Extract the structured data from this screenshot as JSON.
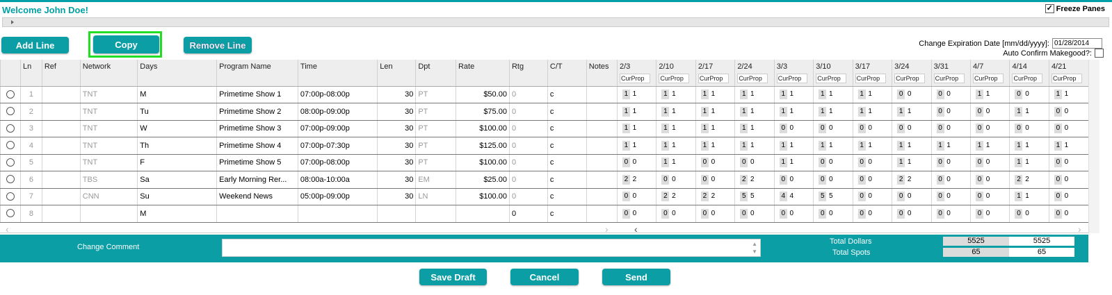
{
  "header": {
    "welcome": "Welcome John Doe!",
    "freeze_label": "Freeze Panes"
  },
  "toolbar": {
    "add": "Add Line",
    "copy": "Copy",
    "remove": "Remove Line"
  },
  "expiration": {
    "label": "Change Expiration Date [mm/dd/yyyy]:",
    "value": "01/28/2014",
    "auto_confirm": "Auto Confirm Makegood?:"
  },
  "columns": [
    "Ln",
    "Ref",
    "Network",
    "Days",
    "Program Name",
    "Time",
    "Len",
    "Dpt",
    "Rate",
    "Rtg",
    "C/T",
    "Notes"
  ],
  "weeks": [
    "2/3",
    "2/10",
    "2/17",
    "2/24",
    "3/3",
    "3/10",
    "3/17",
    "3/24",
    "3/31",
    "4/7",
    "4/14",
    "4/21"
  ],
  "sub_label": "CurProp",
  "rows": [
    {
      "ln": "1",
      "ref": "",
      "network": "TNT",
      "days": "M",
      "program": "Primetime Show 1",
      "time": "07:00p-08:00p",
      "len": "30",
      "dpt": "PT",
      "rate": "$50.00",
      "rtg": "0",
      "ct": "c",
      "notes": "",
      "spots": [
        [
          "1",
          "1"
        ],
        [
          "1",
          "1"
        ],
        [
          "1",
          "1"
        ],
        [
          "1",
          "1"
        ],
        [
          "1",
          "1"
        ],
        [
          "1",
          "1"
        ],
        [
          "1",
          "1"
        ],
        [
          "0",
          "0"
        ],
        [
          "0",
          "0"
        ],
        [
          "1",
          "1"
        ],
        [
          "0",
          "0"
        ],
        [
          "1",
          "1"
        ]
      ]
    },
    {
      "ln": "2",
      "ref": "",
      "network": "TNT",
      "days": "Tu",
      "program": "Primetime Show 2",
      "time": "08:00p-09:00p",
      "len": "30",
      "dpt": "PT",
      "rate": "$75.00",
      "rtg": "0",
      "ct": "c",
      "notes": "",
      "spots": [
        [
          "1",
          "1"
        ],
        [
          "1",
          "1"
        ],
        [
          "1",
          "1"
        ],
        [
          "1",
          "1"
        ],
        [
          "1",
          "1"
        ],
        [
          "1",
          "1"
        ],
        [
          "1",
          "1"
        ],
        [
          "1",
          "1"
        ],
        [
          "0",
          "0"
        ],
        [
          "0",
          "0"
        ],
        [
          "1",
          "1"
        ],
        [
          "0",
          "0"
        ]
      ]
    },
    {
      "ln": "3",
      "ref": "",
      "network": "TNT",
      "days": "W",
      "program": "Primetime Show 3",
      "time": "07:00p-09:00p",
      "len": "30",
      "dpt": "PT",
      "rate": "$100.00",
      "rtg": "0",
      "ct": "c",
      "notes": "",
      "spots": [
        [
          "1",
          "1"
        ],
        [
          "1",
          "1"
        ],
        [
          "1",
          "1"
        ],
        [
          "1",
          "1"
        ],
        [
          "0",
          "0"
        ],
        [
          "0",
          "0"
        ],
        [
          "0",
          "0"
        ],
        [
          "0",
          "0"
        ],
        [
          "0",
          "0"
        ],
        [
          "0",
          "0"
        ],
        [
          "0",
          "0"
        ],
        [
          "0",
          "0"
        ]
      ]
    },
    {
      "ln": "4",
      "ref": "",
      "network": "TNT",
      "days": "Th",
      "program": "Primetime Show 4",
      "time": "07:00p-07:30p",
      "len": "30",
      "dpt": "PT",
      "rate": "$125.00",
      "rtg": "0",
      "ct": "c",
      "notes": "",
      "spots": [
        [
          "1",
          "1"
        ],
        [
          "1",
          "1"
        ],
        [
          "1",
          "1"
        ],
        [
          "1",
          "1"
        ],
        [
          "1",
          "1"
        ],
        [
          "1",
          "1"
        ],
        [
          "1",
          "1"
        ],
        [
          "1",
          "1"
        ],
        [
          "1",
          "1"
        ],
        [
          "1",
          "1"
        ],
        [
          "1",
          "1"
        ],
        [
          "1",
          "1"
        ]
      ]
    },
    {
      "ln": "5",
      "ref": "",
      "network": "TNT",
      "days": "F",
      "program": "Primetime Show 5",
      "time": "07:00p-08:00p",
      "len": "30",
      "dpt": "PT",
      "rate": "$100.00",
      "rtg": "0",
      "ct": "c",
      "notes": "",
      "spots": [
        [
          "0",
          "0"
        ],
        [
          "1",
          "1"
        ],
        [
          "0",
          "0"
        ],
        [
          "0",
          "0"
        ],
        [
          "1",
          "1"
        ],
        [
          "0",
          "0"
        ],
        [
          "0",
          "0"
        ],
        [
          "1",
          "1"
        ],
        [
          "0",
          "0"
        ],
        [
          "0",
          "0"
        ],
        [
          "1",
          "1"
        ],
        [
          "0",
          "0"
        ]
      ]
    },
    {
      "ln": "6",
      "ref": "",
      "network": "TBS",
      "days": "Sa",
      "program": "Early Morning Rer...",
      "time": "08:00a-10:00a",
      "len": "30",
      "dpt": "EM",
      "rate": "$25.00",
      "rtg": "0",
      "ct": "c",
      "notes": "",
      "spots": [
        [
          "2",
          "2"
        ],
        [
          "0",
          "0"
        ],
        [
          "0",
          "0"
        ],
        [
          "2",
          "2"
        ],
        [
          "0",
          "0"
        ],
        [
          "0",
          "0"
        ],
        [
          "0",
          "0"
        ],
        [
          "2",
          "2"
        ],
        [
          "0",
          "0"
        ],
        [
          "0",
          "0"
        ],
        [
          "2",
          "2"
        ],
        [
          "0",
          "0"
        ]
      ]
    },
    {
      "ln": "7",
      "ref": "",
      "network": "CNN",
      "days": "Su",
      "program": "Weekend News",
      "time": "05:00p-09:00p",
      "len": "30",
      "dpt": "LN",
      "rate": "$100.00",
      "rtg": "0",
      "ct": "c",
      "notes": "",
      "spots": [
        [
          "0",
          "0"
        ],
        [
          "2",
          "2"
        ],
        [
          "2",
          "2"
        ],
        [
          "5",
          "5"
        ],
        [
          "4",
          "4"
        ],
        [
          "5",
          "5"
        ],
        [
          "0",
          "0"
        ],
        [
          "0",
          "0"
        ],
        [
          "0",
          "0"
        ],
        [
          "0",
          "0"
        ],
        [
          "1",
          "1"
        ],
        [
          "0",
          "0"
        ]
      ]
    },
    {
      "ln": "8",
      "ref": "",
      "network": "",
      "days": "M",
      "program": "",
      "time": "",
      "len": "",
      "dpt": "",
      "rate": "",
      "rtg": "0",
      "ct": "c",
      "notes": "",
      "spots": [
        [
          "0",
          "0"
        ],
        [
          "0",
          "0"
        ],
        [
          "0",
          "0"
        ],
        [
          "0",
          "0"
        ],
        [
          "0",
          "0"
        ],
        [
          "0",
          "0"
        ],
        [
          "0",
          "0"
        ],
        [
          "0",
          "0"
        ],
        [
          "0",
          "0"
        ],
        [
          "0",
          "0"
        ],
        [
          "0",
          "0"
        ],
        [
          "0",
          "0"
        ]
      ]
    }
  ],
  "footer": {
    "change_comment": "Change Comment",
    "total_dollars_label": "Total Dollars",
    "total_spots_label": "Total Spots",
    "total_dollars_a": "5525",
    "total_dollars_b": "5525",
    "total_spots_a": "65",
    "total_spots_b": "65"
  },
  "actions": {
    "save": "Save Draft",
    "cancel": "Cancel",
    "send": "Send"
  },
  "colors": {
    "accent": "#0b9ea5",
    "copy_highlight": "#22dd22"
  }
}
